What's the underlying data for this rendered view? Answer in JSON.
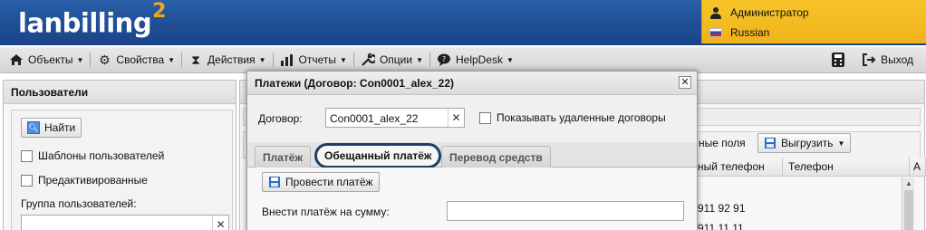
{
  "header": {
    "logo_text": "lanbilling",
    "logo_sup": "2",
    "user_name": "Администратор",
    "language": "Russian",
    "user_icon": "user-icon",
    "flag_icon": "russian-flag-icon",
    "colors": {
      "header_blue": "#1e4c93",
      "user_box": "#f2b81f",
      "logo_accent": "#f2a61e"
    }
  },
  "menubar": {
    "items": [
      {
        "label": "Объекты",
        "icon": "house-icon"
      },
      {
        "label": "Свойства",
        "icon": "gear-icon"
      },
      {
        "label": "Действия",
        "icon": "hourglass-icon"
      },
      {
        "label": "Отчеты",
        "icon": "bar-chart-icon"
      },
      {
        "label": "Опции",
        "icon": "wrench-icon"
      },
      {
        "label": "HelpDesk",
        "icon": "speech-bubble-icon"
      }
    ],
    "exit_label": "Выход",
    "calculator_icon": "calculator-icon",
    "exit_icon": "exit-icon"
  },
  "left_panel": {
    "title": "Пользователи",
    "find_button": "Найти",
    "checkbox_templates": "Шаблоны пользователей",
    "checkbox_preactivated": "Предактивированные",
    "group_label": "Группа пользователей:",
    "group_value": ""
  },
  "right_panel": {
    "fields_button_partial": "ные поля",
    "export_button": "Выгрузить",
    "columns": [
      "ный телефон",
      "Телефон"
    ],
    "rows": [
      "911 92 91",
      "911 11 11"
    ]
  },
  "modal": {
    "title": "Платежи (Договор: Con0001_alex_22)",
    "contract_label": "Договор:",
    "contract_value": "Con0001_alex_22",
    "show_deleted_label": "Показывать удаленные договоры",
    "tabs": [
      {
        "label": "Платёж",
        "active": false
      },
      {
        "label": "Обещанный платёж",
        "active": true
      },
      {
        "label": "Перевод средств",
        "active": false
      }
    ],
    "submit_button": "Провести платёж",
    "amount_label": "Внести платёж на сумму:",
    "amount_value": ""
  }
}
